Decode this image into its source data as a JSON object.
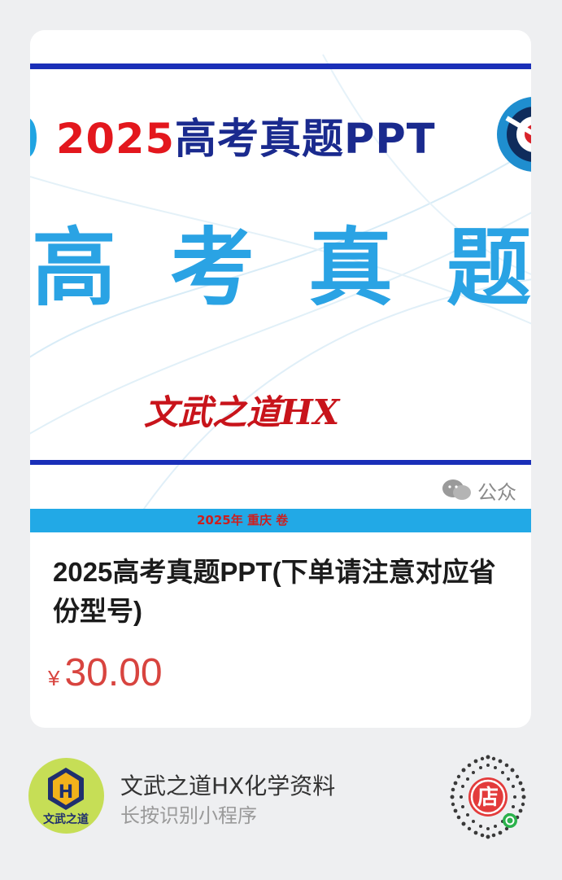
{
  "product": {
    "image": {
      "title_year": "2025",
      "title_rest": "高考真题PPT",
      "big_chars": [
        "高",
        "考",
        "真",
        "题"
      ],
      "author": "文武之道HX",
      "wechat_text": "公众",
      "footer_text": "2025年 重庆 卷"
    },
    "title": "2025高考真题PPT(下单请注意对应省份型号)",
    "price": {
      "currency": "¥",
      "value": "30.00"
    }
  },
  "shop": {
    "avatar_text": "文武之道",
    "name": "文武之道HX化学资料",
    "hint": "长按识别小程序",
    "qr_center": "店"
  },
  "colors": {
    "background": "#eeeff1",
    "price": "#d8443f",
    "title_red": "#e3171d",
    "title_navy": "#1a2a8e",
    "big_text_blue": "#2aa3e4",
    "bar_blue": "#1a2fb8",
    "avatar_green": "#c6de56",
    "qr_red": "#e33b3b"
  }
}
